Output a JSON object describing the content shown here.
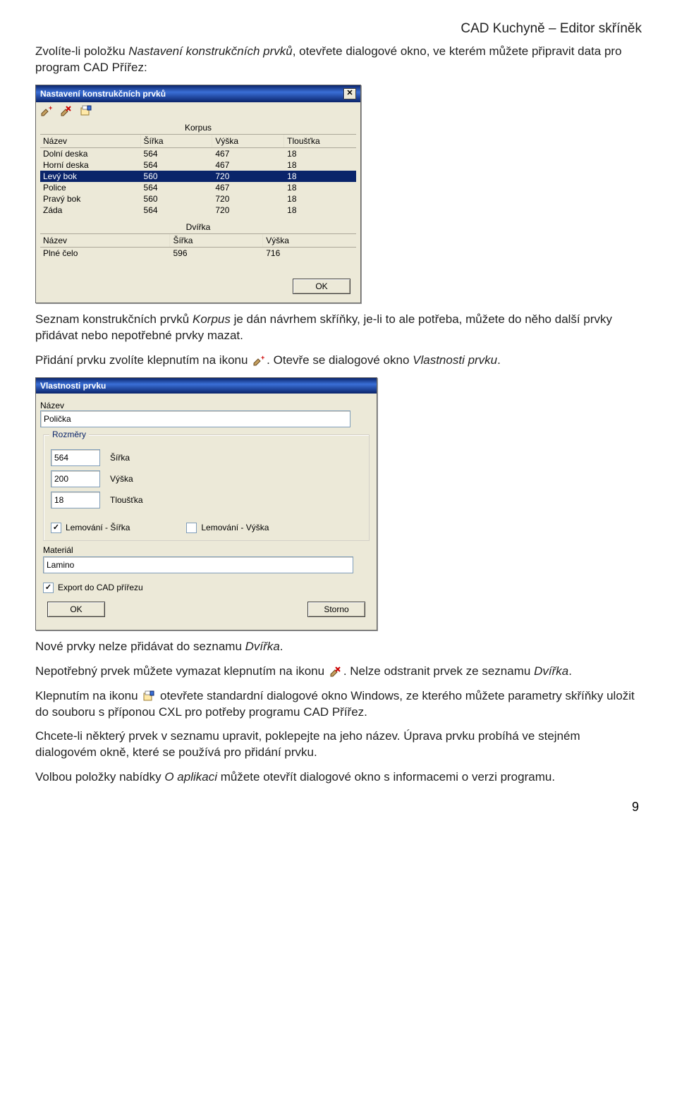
{
  "header": "CAD Kuchyně – Editor skříněk",
  "para1_a": "Zvolíte-li položku ",
  "para1_i": "Nastavení konstrukčních prvků",
  "para1_b": ", otevřete dialogové okno, ve kterém můžete připravit data pro program CAD Přířez:",
  "dlg1": {
    "title": "Nastavení konstrukčních prvků",
    "sec1": "Korpus",
    "cols": {
      "c0": "Název",
      "c1": "Šířka",
      "c2": "Výška",
      "c3": "Tloušťka"
    },
    "rows": [
      {
        "c0": "Dolní deska",
        "c1": "564",
        "c2": "467",
        "c3": "18"
      },
      {
        "c0": "Horní deska",
        "c1": "564",
        "c2": "467",
        "c3": "18"
      },
      {
        "c0": "Levý bok",
        "c1": "560",
        "c2": "720",
        "c3": "18",
        "sel": true
      },
      {
        "c0": "Police",
        "c1": "564",
        "c2": "467",
        "c3": "18"
      },
      {
        "c0": "Pravý bok",
        "c1": "560",
        "c2": "720",
        "c3": "18"
      },
      {
        "c0": "Záda",
        "c1": "564",
        "c2": "720",
        "c3": "18"
      }
    ],
    "sec2": "Dvířka",
    "dcols": {
      "c0": "Název",
      "c1": "Šířka",
      "c2": "Výška"
    },
    "drow": {
      "c0": "Plné čelo",
      "c1": "596",
      "c2": "716"
    },
    "ok": "OK"
  },
  "para2_a": "Seznam konstrukčních prvků ",
  "para2_i1": "Korpus",
  "para2_b": " je dán návrhem skříňky, je-li to ale potřeba, můžete do něho další prvky přidávat nebo nepotřebné prvky mazat.",
  "para3_a": "Přidání prvku zvolíte klepnutím na ikonu ",
  "para3_b": ". Otevře se dialogové okno ",
  "para3_i": "Vlastnosti prvku",
  "para3_c": ".",
  "dlg2": {
    "title": "Vlastnosti prvku",
    "name_lbl": "Název",
    "name_val": "Polička",
    "rozmery": "Rozměry",
    "sirka_val": "564",
    "sirka_lbl": "Šířka",
    "vyska_val": "200",
    "vyska_lbl": "Výška",
    "tl_val": "18",
    "tl_lbl": "Tloušťka",
    "lem_s": "Lemování - Šířka",
    "lem_v": "Lemování - Výška",
    "mat_lbl": "Materiál",
    "mat_val": "Lamino",
    "export_lbl": "Export do CAD přířezu",
    "ok": "OK",
    "storno": "Storno"
  },
  "para4_a": "Nové prvky nelze přidávat do seznamu ",
  "para4_i": "Dvířka",
  "para4_b": ".",
  "para5_a": "Nepotřebný prvek můžete vymazat klepnutím na ikonu ",
  "para5_b": ". Nelze odstranit prvek ze seznamu ",
  "para5_i": "Dvířka",
  "para5_c": ".",
  "para6_a": "Klepnutím na ikonu ",
  "para6_b": " otevřete standardní dialogové okno Windows, ze kterého můžete parametry skříňky uložit do souboru s příponou CXL pro potřeby programu CAD Přířez.",
  "para7": "Chcete-li některý prvek v seznamu upravit, poklepejte na jeho název. Úprava prvku probíhá ve stejném dialogovém okně, které se používá pro přidání prvku.",
  "para8_a": "Volbou položky nabídky ",
  "para8_i": "O aplikaci",
  "para8_b": " můžete otevřít dialogové okno s informacemi o verzi programu.",
  "pagenum": "9"
}
